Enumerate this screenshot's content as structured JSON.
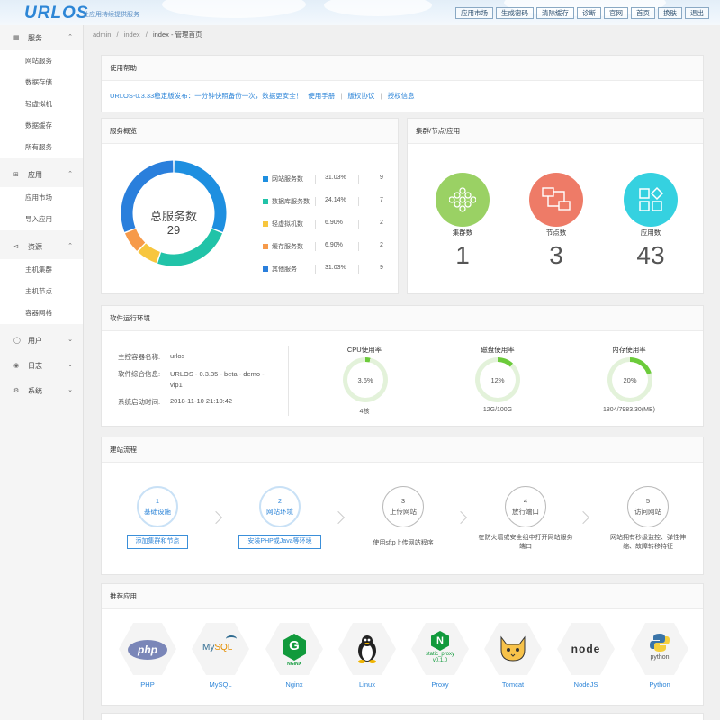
{
  "header": {
    "logo": "URLOS",
    "slogan": "让应用持续提供服务",
    "nav": [
      "应用市场",
      "生成密码",
      "清除缓存",
      "诊断",
      "官网",
      "首页",
      "换肤",
      "退出"
    ]
  },
  "sidebar": {
    "groups": [
      {
        "label": "服务",
        "icon": "grid-icon",
        "items": [
          "网站服务",
          "数据存储",
          "轻虚拟机",
          "数据缓存",
          "所有服务"
        ]
      },
      {
        "label": "应用",
        "icon": "apps-icon",
        "items": [
          "应用市场",
          "导入应用"
        ]
      },
      {
        "label": "资源",
        "icon": "share-icon",
        "items": [
          "主机集群",
          "主机节点",
          "容器网格"
        ]
      },
      {
        "label": "用户",
        "icon": "user-icon",
        "items": []
      },
      {
        "label": "日志",
        "icon": "eye-icon",
        "items": []
      },
      {
        "label": "系统",
        "icon": "gear-icon",
        "items": []
      }
    ]
  },
  "breadcrumb": [
    "admin",
    "/",
    "index",
    "/",
    "index - 管理首页"
  ],
  "help": {
    "title": "使用帮助",
    "announcement": "URLOS-0.3.33稳定版发布：一分钟快照备份一次，数据更安全！",
    "links": [
      "使用手册",
      "版权协议",
      "授权信息"
    ]
  },
  "overview": {
    "title": "服务概览",
    "center_label": "总服务数",
    "total": "29",
    "chart_data": {
      "type": "pie",
      "title": "",
      "categories": [
        "网站服务数",
        "数据库服务数",
        "轻虚拟机数",
        "缓存服务数",
        "其他服务"
      ],
      "percent_labels": [
        "31.03%",
        "24.14%",
        "6.90%",
        "6.90%",
        "31.03%"
      ],
      "values": [
        9,
        7,
        2,
        2,
        9
      ],
      "colors": [
        "#1e8fe0",
        "#21c3a8",
        "#f7c63e",
        "#f69a4a",
        "#2a7fdc"
      ]
    }
  },
  "cluster": {
    "title": "集群/节点/应用",
    "items": [
      {
        "label": "集群数",
        "value": "1",
        "color": "#9ad164",
        "icon": "hexagon-cluster-icon"
      },
      {
        "label": "节点数",
        "value": "3",
        "color": "#ee7b67",
        "icon": "node-network-icon"
      },
      {
        "label": "应用数",
        "value": "43",
        "color": "#35d1e0",
        "icon": "apps-grid-icon"
      }
    ]
  },
  "env": {
    "title": "软件运行环境",
    "rows": [
      {
        "label": "主控容器名称:",
        "value": "urlos"
      },
      {
        "label": "软件综合信息:",
        "value": "URLOS - 0.3.35 - beta - demo - vip1"
      },
      {
        "label": "系统启动时间:",
        "value": "2018-11-10 21:10:42"
      }
    ],
    "gauges": [
      {
        "label": "CPU使用率",
        "percent": 3.6,
        "text": "3.6%",
        "sub": "4核"
      },
      {
        "label": "磁盘使用率",
        "percent": 12,
        "text": "12%",
        "sub": "12G/100G"
      },
      {
        "label": "内存使用率",
        "percent": 20,
        "text": "20%",
        "sub": "1804/7983.30(MB)"
      }
    ],
    "gauge_color": "#6ccb3b",
    "gauge_track": "#e3f2da"
  },
  "flow": {
    "title": "建站流程",
    "steps": [
      {
        "num": "1",
        "label": "基础设施",
        "button": "添加集群和节点",
        "desc": ""
      },
      {
        "num": "2",
        "label": "网站环境",
        "button": "安装PHP或Java等环境",
        "desc": ""
      },
      {
        "num": "3",
        "label": "上传网站",
        "button": "",
        "desc": "使用sftp上传网站程序"
      },
      {
        "num": "4",
        "label": "放行端口",
        "button": "",
        "desc": "在防火墙或安全组中打开网站服务端口"
      },
      {
        "num": "5",
        "label": "访问网站",
        "button": "",
        "desc": "网站拥有秒级监控、弹性伸缩、故障转移特征"
      }
    ]
  },
  "apps": {
    "title": "推荐应用",
    "items": [
      {
        "name": "PHP",
        "icon": "php-logo-icon"
      },
      {
        "name": "MySQL",
        "icon": "mysql-logo-icon"
      },
      {
        "name": "Nginx",
        "icon": "nginx-logo-icon"
      },
      {
        "name": "Linux",
        "icon": "linux-tux-icon"
      },
      {
        "name": "Proxy",
        "icon": "proxy-logo-icon",
        "logo_text": "static_proxy",
        "logo_version": "v0.1.0"
      },
      {
        "name": "Tomcat",
        "icon": "tomcat-logo-icon"
      },
      {
        "name": "NodeJS",
        "icon": "nodejs-logo-icon"
      },
      {
        "name": "Python",
        "icon": "python-logo-icon",
        "logo_text": "python"
      }
    ]
  }
}
